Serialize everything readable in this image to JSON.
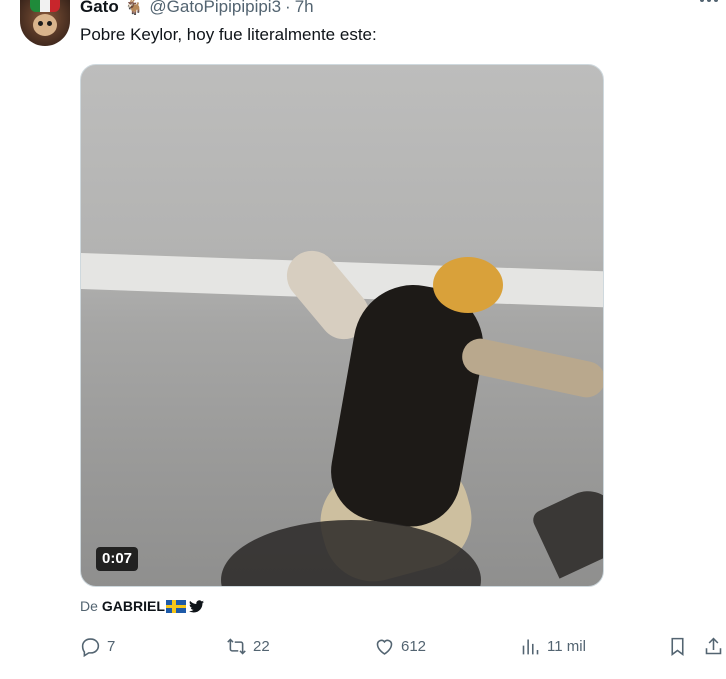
{
  "tweet": {
    "author_name": "Gato",
    "author_handle": "@GatoPipipipipi3",
    "separator": "·",
    "time": "7h",
    "text": "Pobre Keylor, hoy fue literalmente este:",
    "media": {
      "duration": "0:07"
    },
    "attribution": {
      "prefix": "De",
      "author": "GABRIEL"
    }
  },
  "actions": {
    "replies": "7",
    "retweets": "22",
    "likes": "612",
    "views": "11 mil"
  },
  "icons": {
    "goat": "goat-emoji-icon",
    "more": "more-icon",
    "reply": "reply-icon",
    "retweet": "retweet-icon",
    "like": "heart-icon",
    "views": "views-chart-icon",
    "bookmark": "bookmark-icon",
    "share": "share-icon",
    "flag": "sweden-flag-icon",
    "bird": "twitter-bird-icon"
  },
  "colors": {
    "text_primary": "#0f1419",
    "text_secondary": "#536471",
    "border": "#cfd9de"
  }
}
